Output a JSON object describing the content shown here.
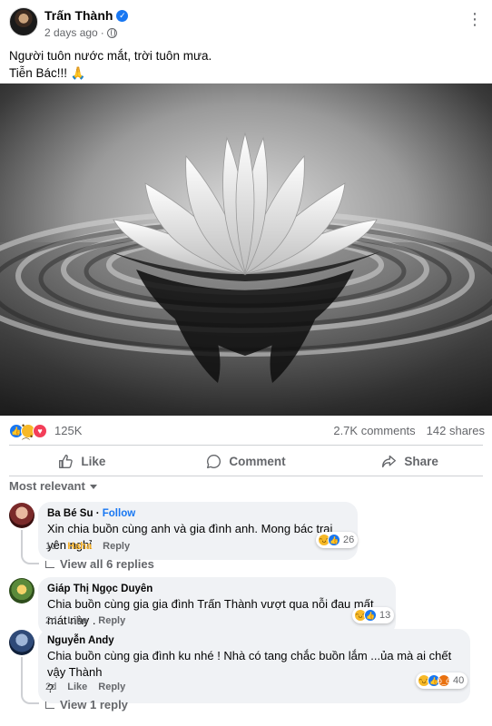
{
  "post": {
    "author": "Trấn Thành",
    "time": "2 days ago",
    "caption_line1": "Người tuôn nước mắt, trời tuôn mưa.",
    "caption_line2": "Tiễn Bác!!! 🙏"
  },
  "stats": {
    "reactions": "125K",
    "comments": "2.7K comments",
    "shares": "142 shares"
  },
  "actions": {
    "like": "Like",
    "comment": "Comment",
    "share": "Share"
  },
  "sort_label": "Most relevant",
  "comments": [
    {
      "name": "Ba Bé Su",
      "follow": "Follow",
      "text": "Xin chia buồn cùng anh và gia đình anh. Mong bác trai yên nghỉ",
      "time": "1d",
      "reaction_label": "Haha",
      "reply_label": "Reply",
      "reaction_count": "26",
      "replies": "View all 6 replies"
    },
    {
      "name": "Giáp Thị Ngọc Duyên",
      "text": "Chia buồn cùng gia gia đình Trấn Thành vượt qua nỗi đau mất mát này .",
      "time": "2d",
      "like_label": "Like",
      "reply_label": "Reply",
      "reaction_count": "13"
    },
    {
      "name": "Nguyễn Andy",
      "text_line1": "Chia buồn cùng gia đình ku nhé ! Nhà có tang chắc buồn lắm ...ủa mà ai chết vậy Thành",
      "text_line2": "?",
      "time": "2d",
      "like_label": "Like",
      "reply_label": "Reply",
      "reaction_count": "40",
      "replies": "View 1 reply"
    }
  ],
  "colors": {
    "accent": "#1877f2",
    "muted": "#65676b",
    "bubble": "#f0f2f5",
    "haha": "#f7b125"
  }
}
